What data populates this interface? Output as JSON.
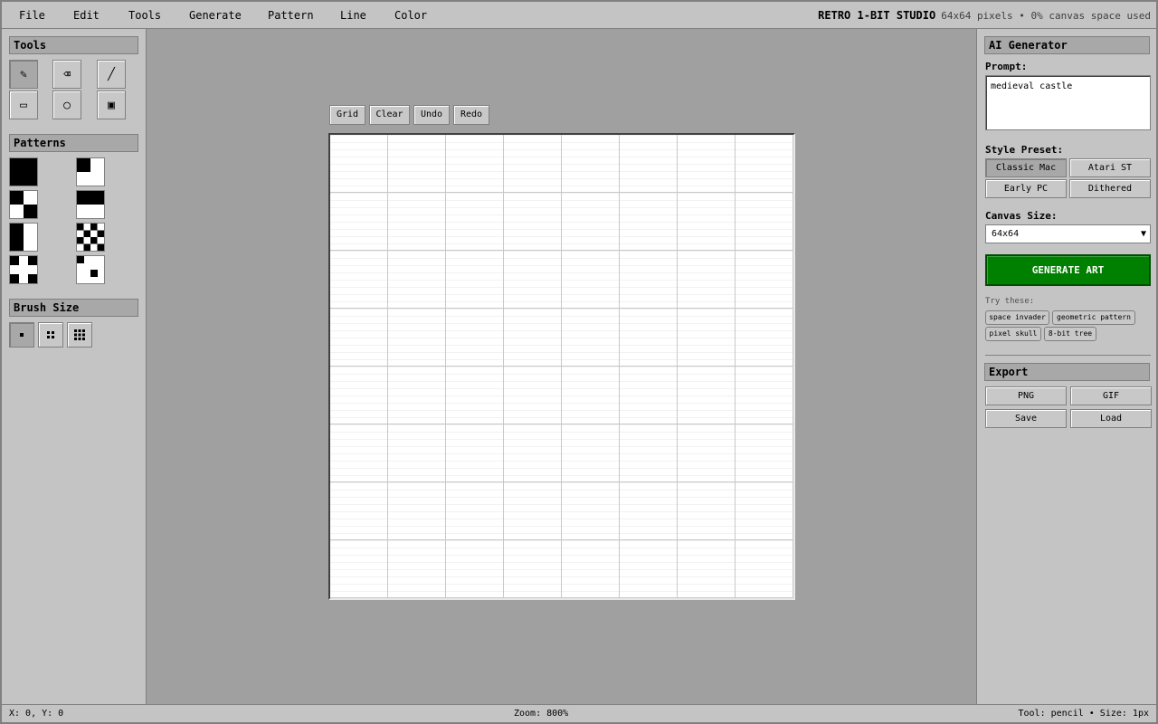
{
  "menu": {
    "items": [
      "File",
      "Edit",
      "Tools",
      "Generate",
      "Pattern",
      "Line",
      "Color"
    ]
  },
  "header": {
    "app_name": "RETRO 1-BIT STUDIO",
    "meta": "64x64 pixels • 0% canvas space used"
  },
  "left": {
    "tools_title": "Tools",
    "tools": [
      {
        "name": "pencil",
        "glyph": "✎",
        "active": true
      },
      {
        "name": "eraser",
        "glyph": "⌫",
        "active": false
      },
      {
        "name": "line",
        "glyph": "╱",
        "active": false
      },
      {
        "name": "rectangle",
        "glyph": "▭",
        "active": false
      },
      {
        "name": "ellipse",
        "glyph": "○",
        "active": false
      },
      {
        "name": "fill",
        "glyph": "▣",
        "active": false
      }
    ],
    "patterns_title": "Patterns",
    "brush_title": "Brush Size"
  },
  "canvas_tools": {
    "grid": "Grid",
    "clear": "Clear",
    "undo": "Undo",
    "redo": "Redo"
  },
  "ai": {
    "title": "AI Generator",
    "prompt_label": "Prompt:",
    "prompt_value": "medieval castle",
    "style_label": "Style Preset:",
    "presets": [
      "Classic Mac",
      "Atari ST",
      "Early PC",
      "Dithered"
    ],
    "active_preset": "Classic Mac",
    "canvas_size_label": "Canvas Size:",
    "canvas_size_value": "64x64",
    "generate_label": "GENERATE ART",
    "generate_color": "#008000",
    "try_label": "Try these:",
    "suggestions": [
      "space invader",
      "geometric pattern",
      "pixel skull",
      "8-bit tree"
    ]
  },
  "export": {
    "title": "Export",
    "png": "PNG",
    "gif": "GIF",
    "save": "Save",
    "load": "Load"
  },
  "status": {
    "coords": "X: 0, Y: 0",
    "zoom": "Zoom: 800%",
    "tool": "Tool: pencil • Size: 1px"
  }
}
